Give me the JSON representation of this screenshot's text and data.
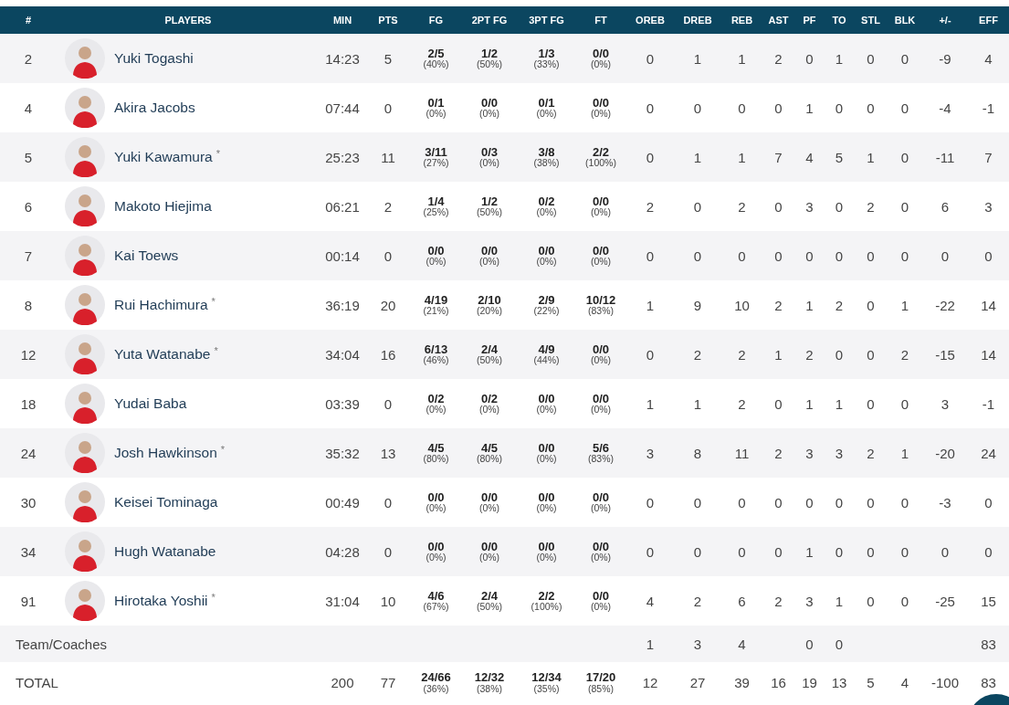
{
  "columns": [
    "#",
    "PLAYERS",
    "MIN",
    "PTS",
    "FG",
    "2PT FG",
    "3PT FG",
    "FT",
    "OREB",
    "DREB",
    "REB",
    "AST",
    "PF",
    "TO",
    "STL",
    "BLK",
    "+/-",
    "EFF"
  ],
  "players": [
    {
      "number": "2",
      "name": "Yuki Togashi",
      "stats": [
        "14:23",
        "5",
        {
          "made": "2/5",
          "pct": "(40%)"
        },
        {
          "made": "1/2",
          "pct": "(50%)"
        },
        {
          "made": "1/3",
          "pct": "(33%)"
        },
        {
          "made": "0/0",
          "pct": "(0%)"
        },
        "0",
        "1",
        "1",
        "2",
        "0",
        "1",
        "0",
        "0",
        "-9",
        "4"
      ]
    },
    {
      "number": "4",
      "name": "Akira Jacobs",
      "stats": [
        "07:44",
        "0",
        {
          "made": "0/1",
          "pct": "(0%)"
        },
        {
          "made": "0/0",
          "pct": "(0%)"
        },
        {
          "made": "0/1",
          "pct": "(0%)"
        },
        {
          "made": "0/0",
          "pct": "(0%)"
        },
        "0",
        "0",
        "0",
        "0",
        "1",
        "0",
        "0",
        "0",
        "-4",
        "-1"
      ]
    },
    {
      "number": "5",
      "name": "Yuki Kawamura",
      "starter_mark": "*",
      "stats": [
        "25:23",
        "11",
        {
          "made": "3/11",
          "pct": "(27%)"
        },
        {
          "made": "0/3",
          "pct": "(0%)"
        },
        {
          "made": "3/8",
          "pct": "(38%)"
        },
        {
          "made": "2/2",
          "pct": "(100%)"
        },
        "0",
        "1",
        "1",
        "7",
        "4",
        "5",
        "1",
        "0",
        "-11",
        "7"
      ]
    },
    {
      "number": "6",
      "name": "Makoto Hiejima",
      "stats": [
        "06:21",
        "2",
        {
          "made": "1/4",
          "pct": "(25%)"
        },
        {
          "made": "1/2",
          "pct": "(50%)"
        },
        {
          "made": "0/2",
          "pct": "(0%)"
        },
        {
          "made": "0/0",
          "pct": "(0%)"
        },
        "2",
        "0",
        "2",
        "0",
        "3",
        "0",
        "2",
        "0",
        "6",
        "3"
      ]
    },
    {
      "number": "7",
      "name": "Kai Toews",
      "stats": [
        "00:14",
        "0",
        {
          "made": "0/0",
          "pct": "(0%)"
        },
        {
          "made": "0/0",
          "pct": "(0%)"
        },
        {
          "made": "0/0",
          "pct": "(0%)"
        },
        {
          "made": "0/0",
          "pct": "(0%)"
        },
        "0",
        "0",
        "0",
        "0",
        "0",
        "0",
        "0",
        "0",
        "0",
        "0"
      ]
    },
    {
      "number": "8",
      "name": "Rui Hachimura",
      "starter_mark": "*",
      "stats": [
        "36:19",
        "20",
        {
          "made": "4/19",
          "pct": "(21%)"
        },
        {
          "made": "2/10",
          "pct": "(20%)"
        },
        {
          "made": "2/9",
          "pct": "(22%)"
        },
        {
          "made": "10/12",
          "pct": "(83%)"
        },
        "1",
        "9",
        "10",
        "2",
        "1",
        "2",
        "0",
        "1",
        "-22",
        "14"
      ]
    },
    {
      "number": "12",
      "name": "Yuta Watanabe",
      "starter_mark": "*",
      "stats": [
        "34:04",
        "16",
        {
          "made": "6/13",
          "pct": "(46%)"
        },
        {
          "made": "2/4",
          "pct": "(50%)"
        },
        {
          "made": "4/9",
          "pct": "(44%)"
        },
        {
          "made": "0/0",
          "pct": "(0%)"
        },
        "0",
        "2",
        "2",
        "1",
        "2",
        "0",
        "0",
        "2",
        "-15",
        "14"
      ]
    },
    {
      "number": "18",
      "name": "Yudai Baba",
      "stats": [
        "03:39",
        "0",
        {
          "made": "0/2",
          "pct": "(0%)"
        },
        {
          "made": "0/2",
          "pct": "(0%)"
        },
        {
          "made": "0/0",
          "pct": "(0%)"
        },
        {
          "made": "0/0",
          "pct": "(0%)"
        },
        "1",
        "1",
        "2",
        "0",
        "1",
        "1",
        "0",
        "0",
        "3",
        "-1"
      ]
    },
    {
      "number": "24",
      "name": "Josh Hawkinson",
      "starter_mark": "*",
      "stats": [
        "35:32",
        "13",
        {
          "made": "4/5",
          "pct": "(80%)"
        },
        {
          "made": "4/5",
          "pct": "(80%)"
        },
        {
          "made": "0/0",
          "pct": "(0%)"
        },
        {
          "made": "5/6",
          "pct": "(83%)"
        },
        "3",
        "8",
        "11",
        "2",
        "3",
        "3",
        "2",
        "1",
        "-20",
        "24"
      ]
    },
    {
      "number": "30",
      "name": "Keisei Tominaga",
      "stats": [
        "00:49",
        "0",
        {
          "made": "0/0",
          "pct": "(0%)"
        },
        {
          "made": "0/0",
          "pct": "(0%)"
        },
        {
          "made": "0/0",
          "pct": "(0%)"
        },
        {
          "made": "0/0",
          "pct": "(0%)"
        },
        "0",
        "0",
        "0",
        "0",
        "0",
        "0",
        "0",
        "0",
        "-3",
        "0"
      ]
    },
    {
      "number": "34",
      "name": "Hugh Watanabe",
      "stats": [
        "04:28",
        "0",
        {
          "made": "0/0",
          "pct": "(0%)"
        },
        {
          "made": "0/0",
          "pct": "(0%)"
        },
        {
          "made": "0/0",
          "pct": "(0%)"
        },
        {
          "made": "0/0",
          "pct": "(0%)"
        },
        "0",
        "0",
        "0",
        "0",
        "1",
        "0",
        "0",
        "0",
        "0",
        "0"
      ]
    },
    {
      "number": "91",
      "name": "Hirotaka Yoshii",
      "starter_mark": "*",
      "stats": [
        "31:04",
        "10",
        {
          "made": "4/6",
          "pct": "(67%)"
        },
        {
          "made": "2/4",
          "pct": "(50%)"
        },
        {
          "made": "2/2",
          "pct": "(100%)"
        },
        {
          "made": "0/0",
          "pct": "(0%)"
        },
        "4",
        "2",
        "6",
        "2",
        "3",
        "1",
        "0",
        "0",
        "-25",
        "15"
      ]
    }
  ],
  "summary_rows": [
    {
      "label": "Team/Coaches",
      "stats": {
        "oreb": "1",
        "dreb": "3",
        "reb": "4",
        "pf": "0",
        "to": "0",
        "eff": "83"
      }
    },
    {
      "label": "TOTAL",
      "stats": [
        "200",
        "77",
        {
          "made": "24/66",
          "pct": "(36%)"
        },
        {
          "made": "12/32",
          "pct": "(38%)"
        },
        {
          "made": "12/34",
          "pct": "(35%)"
        },
        {
          "made": "17/20",
          "pct": "(85%)"
        },
        "12",
        "27",
        "39",
        "16",
        "19",
        "13",
        "5",
        "4",
        "-100",
        "83"
      ]
    }
  ]
}
